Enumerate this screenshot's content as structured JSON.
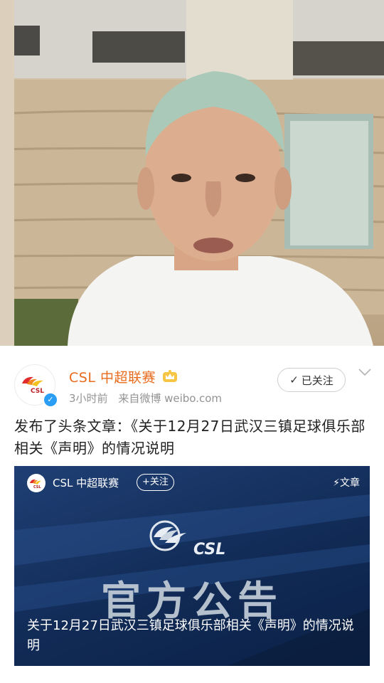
{
  "post": {
    "author": "CSL 中超联赛",
    "time": "3小时前",
    "source": "来自微博 weibo.com",
    "follow_label": "已关注",
    "text": "发布了头条文章：《关于12月27日武汉三镇足球俱乐部相关《声明》的情况说明"
  },
  "article_card": {
    "author": "CSL 中超联赛",
    "follow_label": "+关注",
    "type_label": "文章",
    "logo_text": "CSL",
    "banner_text": "官方公告",
    "title": "关于12月27日武汉三镇足球俱乐部相关《声明》的情况说明"
  },
  "colors": {
    "author_name": "#e86b1d",
    "verified": "#2a9df4",
    "card_background": "#112b56"
  },
  "icons": [
    "verified-icon",
    "crown-icon",
    "check-icon",
    "chevron-down-icon",
    "lightning-icon"
  ]
}
